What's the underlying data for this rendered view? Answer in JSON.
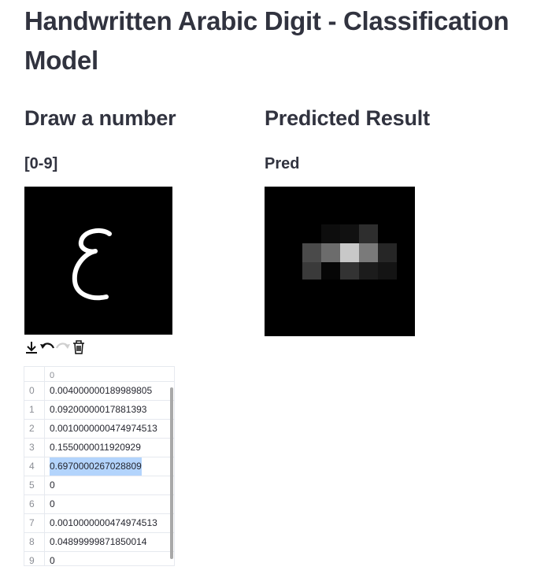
{
  "title": "Handwritten Arabic Digit - Classification Model",
  "left": {
    "heading": "Draw a number",
    "subheading": "[0-9]"
  },
  "right": {
    "heading": "Predicted Result",
    "subheading": "Pred"
  },
  "toolbar": {
    "icons": [
      "download-icon",
      "undo-icon",
      "redo-icon",
      "trash-icon"
    ]
  },
  "table": {
    "column": "0",
    "rows": [
      {
        "index": "0",
        "value": "0.004000000189989805"
      },
      {
        "index": "1",
        "value": "0.09200000017881393"
      },
      {
        "index": "2",
        "value": "0.0010000000474974513"
      },
      {
        "index": "3",
        "value": "0.1550000011920929"
      },
      {
        "index": "4",
        "value": "0.6970000267028809",
        "selected": true
      },
      {
        "index": "5",
        "value": "0"
      },
      {
        "index": "6",
        "value": "0"
      },
      {
        "index": "7",
        "value": "0.0010000000474974513"
      },
      {
        "index": "8",
        "value": "0.04899999871850014"
      },
      {
        "index": "9",
        "value": "0"
      }
    ]
  },
  "colors": {
    "text": "#31333f",
    "selection": "#b3d4fc",
    "canvas": "#000000"
  }
}
